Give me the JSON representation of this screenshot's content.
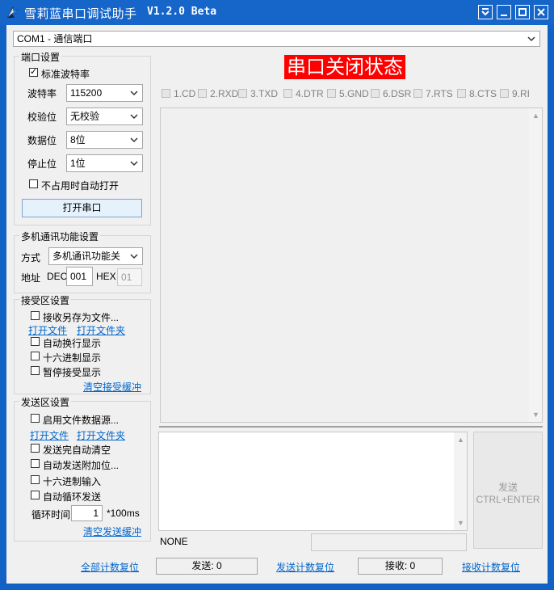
{
  "window": {
    "title": "雪莉蓝串口调试助手",
    "version": "V1.2.0 Beta"
  },
  "port_selector": {
    "value": "COM1 - 通信端口"
  },
  "port_settings": {
    "group_title": "端口设置",
    "standard_baud_label": "标准波特率",
    "standard_baud_checked": true,
    "baud_label": "波特率",
    "baud_value": "115200",
    "parity_label": "校验位",
    "parity_value": "无校验",
    "databits_label": "数据位",
    "databits_value": "8位",
    "stopbits_label": "停止位",
    "stopbits_value": "1位",
    "auto_open_label": "不占用时自动打开",
    "open_button": "打开串口"
  },
  "multi_machine": {
    "group_title": "多机通讯功能设置",
    "mode_label": "方式",
    "mode_value": "多机通讯功能关",
    "address_label": "地址",
    "dec_label": "DEC",
    "dec_value": "001",
    "hex_label": "HEX",
    "hex_value": "01"
  },
  "receive_settings": {
    "group_title": "接受区设置",
    "save_to_file_label": "接收另存为文件...",
    "open_file_link": "打开文件",
    "open_folder_link": "打开文件夹",
    "auto_wrap_label": "自动换行显示",
    "hex_display_label": "十六进制显示",
    "pause_label": "暂停接受显示",
    "clear_link": "清空接受缓冲"
  },
  "send_settings": {
    "group_title": "发送区设置",
    "file_source_label": "启用文件数据源...",
    "open_file_link": "打开文件",
    "open_folder_link": "打开文件夹",
    "auto_clear_label": "发送完自动清空",
    "append_label": "自动发送附加位...",
    "hex_input_label": "十六进制输入",
    "loop_send_label": "自动循环发送",
    "interval_label": "循环时间",
    "interval_value": "1",
    "interval_unit": "*100ms",
    "clear_link": "清空发送缓冲"
  },
  "status_banner": "串口关闭状态",
  "pins": [
    "1.CD",
    "2.RXD",
    "3.TXD",
    "4.DTR",
    "5.GND",
    "6.DSR",
    "7.RTS",
    "8.CTS",
    "9.RI"
  ],
  "send_button": {
    "line1": "发送",
    "line2": "CTRL+ENTER"
  },
  "status_none": "NONE",
  "bottom_bar": {
    "reset_all_link": "全部计数复位",
    "send_count": "发送: 0",
    "reset_send_link": "发送计数复位",
    "recv_count": "接收: 0",
    "reset_recv_link": "接收计数复位"
  },
  "colors": {
    "titlebar": "#1665c8",
    "status_banner_bg": "#ff0000",
    "link": "#0066cc"
  }
}
